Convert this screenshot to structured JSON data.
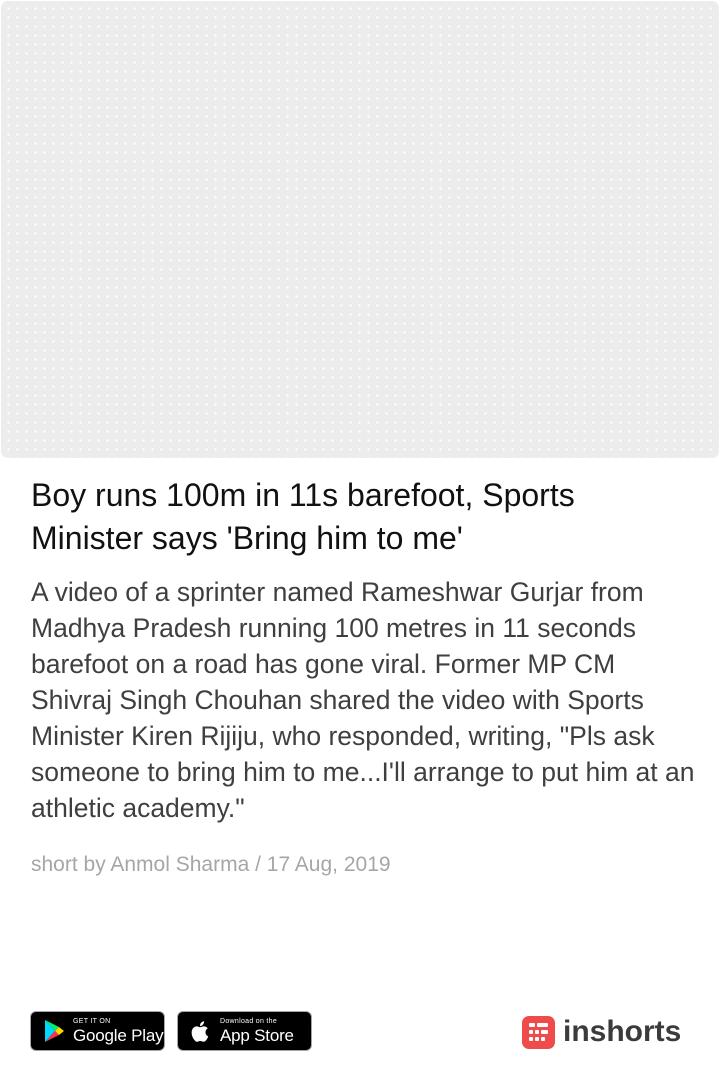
{
  "article": {
    "headline": "Boy runs 100m in 11s barefoot, Sports Minister says 'Bring him to me'",
    "body": "A video of a sprinter named Rameshwar Gurjar from Madhya Pradesh running 100 metres in 11 seconds barefoot on a road has gone viral. Former MP CM Shivraj Singh Chouhan shared the video with Sports Minister Kiren Rijiju, who responded, writing, \"Pls ask someone to bring him to me...I'll arrange to put him at an athletic academy.\"",
    "byline": "short by Anmol Sharma / 17 Aug, 2019"
  },
  "footer": {
    "google_play": {
      "small_label": "GET IT ON",
      "large_label": "Google Play",
      "icon": "google-play-icon"
    },
    "app_store": {
      "small_label": "Download on the",
      "large_label": "App Store",
      "icon": "apple-icon"
    },
    "brand": {
      "name": "inshorts",
      "icon": "inshorts-logo-icon",
      "color": "#ef4b4b"
    }
  }
}
